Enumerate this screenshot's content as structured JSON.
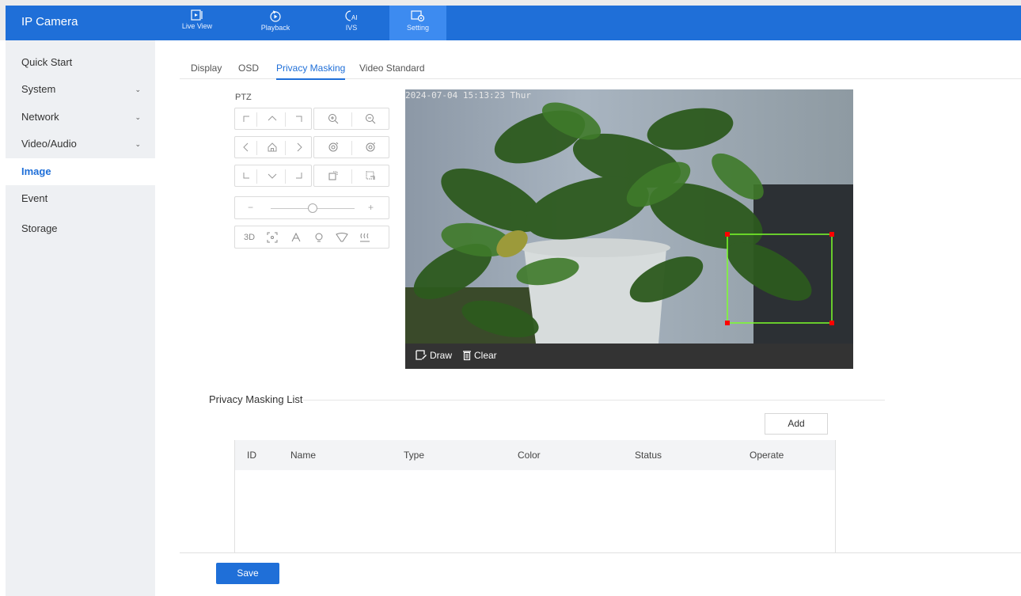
{
  "app": {
    "title": "IP Camera"
  },
  "topnav": [
    {
      "label": "Live View",
      "icon": "live-view-icon"
    },
    {
      "label": "Playback",
      "icon": "playback-icon"
    },
    {
      "label": "IVS",
      "icon": "ai-icon"
    },
    {
      "label": "Setting",
      "icon": "setting-icon",
      "active": true
    }
  ],
  "sidebar": {
    "items": [
      {
        "label": "Quick Start"
      },
      {
        "label": "System",
        "expandable": true
      },
      {
        "label": "Network",
        "expandable": true
      },
      {
        "label": "Video/Audio",
        "expandable": true
      },
      {
        "label": "Image",
        "active": true
      },
      {
        "label": "Event"
      },
      {
        "label": "Storage"
      }
    ]
  },
  "tabs": [
    {
      "label": "Display"
    },
    {
      "label": "OSD"
    },
    {
      "label": "Privacy Masking",
      "active": true
    },
    {
      "label": "Video Standard"
    }
  ],
  "ptz": {
    "title": "PTZ",
    "slider": {
      "minus": "−",
      "plus": "+",
      "value_fraction": 0.5
    },
    "row4": {
      "label_3d": "3D"
    }
  },
  "video": {
    "timestamp": "2024-07-04 15:13:23 Thur",
    "draw_label": "Draw",
    "clear_label": "Clear"
  },
  "privacy_list": {
    "title": "Privacy Masking List",
    "add_label": "Add",
    "columns": [
      "ID",
      "Name",
      "Type",
      "Color",
      "Status",
      "Operate"
    ],
    "rows": []
  },
  "footer": {
    "save_label": "Save"
  },
  "colors": {
    "accent": "#1f6fd8",
    "mask_border": "#7cff2a",
    "mask_handle": "#ff0000"
  }
}
